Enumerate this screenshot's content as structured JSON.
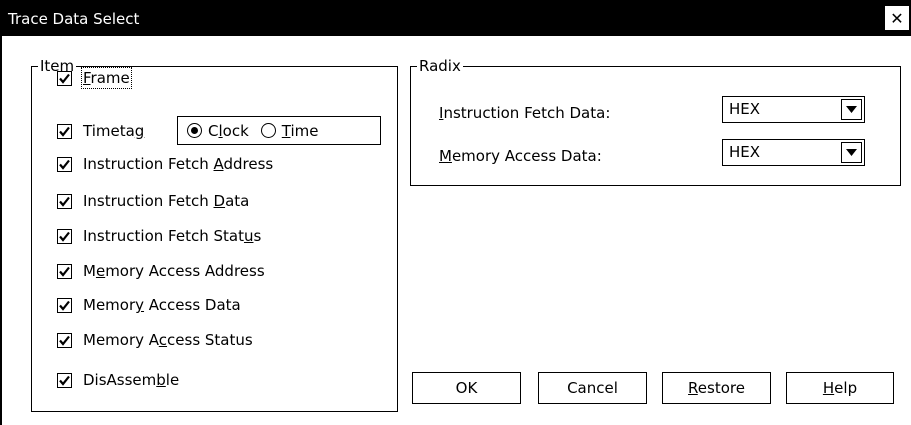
{
  "window": {
    "title": "Trace Data Select",
    "close_glyph": "✕"
  },
  "item_group": {
    "label": "Item",
    "items": [
      {
        "pre": "",
        "mn": "F",
        "post": "rame",
        "checked": true
      },
      {
        "pre": "Timeta",
        "mn": "g",
        "post": "",
        "checked": true
      },
      {
        "pre": "Instruction Fetch ",
        "mn": "A",
        "post": "ddress",
        "checked": true
      },
      {
        "pre": "Instruction Fetch ",
        "mn": "D",
        "post": "ata",
        "checked": true
      },
      {
        "pre": "Instruction Fetch Stat",
        "mn": "u",
        "post": "s",
        "checked": true
      },
      {
        "pre": "M",
        "mn": "e",
        "post": "mory Access Address",
        "checked": true
      },
      {
        "pre": "Memor",
        "mn": "y",
        "post": " Access Data",
        "checked": true
      },
      {
        "pre": "Memory A",
        "mn": "c",
        "post": "cess Status",
        "checked": true
      },
      {
        "pre": "DisAssem",
        "mn": "b",
        "post": "le",
        "checked": true
      }
    ],
    "timetag_options": [
      {
        "pre": "C",
        "mn": "l",
        "post": "ock",
        "selected": true
      },
      {
        "pre": "",
        "mn": "T",
        "post": "ime",
        "selected": false
      }
    ]
  },
  "radix_group": {
    "label": "Radix",
    "fields": [
      {
        "pre": "",
        "mn": "I",
        "post": "nstruction Fetch Data:",
        "value": "HEX"
      },
      {
        "pre": "",
        "mn": "M",
        "post": "emory Access Data:",
        "value": "HEX"
      }
    ]
  },
  "buttons": {
    "ok": {
      "pre": "OK",
      "mn": "",
      "post": ""
    },
    "cancel": {
      "pre": "Cancel",
      "mn": "",
      "post": ""
    },
    "restore": {
      "pre": "",
      "mn": "R",
      "post": "estore"
    },
    "help": {
      "pre": "",
      "mn": "H",
      "post": "elp"
    }
  }
}
